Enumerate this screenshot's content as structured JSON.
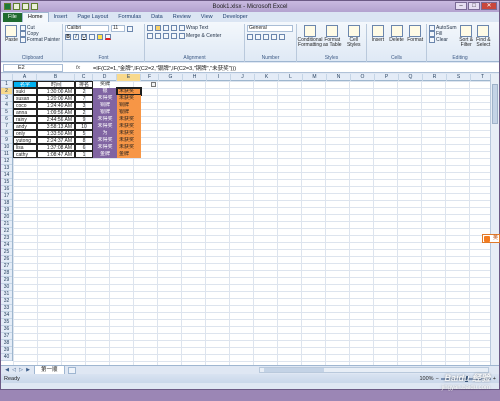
{
  "window": {
    "title": "Book1.xlsx - Microsoft Excel"
  },
  "ribbon_tabs": [
    "File",
    "Home",
    "Insert",
    "Page Layout",
    "Formulas",
    "Data",
    "Review",
    "View",
    "Developer"
  ],
  "ribbon": {
    "clipboard": {
      "paste": "Paste",
      "cut": "Cut",
      "copy": "Copy",
      "format_painter": "Format Painter",
      "label": "Clipboard"
    },
    "font": {
      "name": "Calibri",
      "size": "11",
      "label": "Font"
    },
    "alignment": {
      "wrap": "Wrap Text",
      "merge": "Merge & Center",
      "label": "Alignment"
    },
    "number": {
      "format": "General",
      "label": "Number"
    },
    "styles": {
      "conditional": "Conditional Formatting",
      "format_table": "Format as Table",
      "cell_styles": "Cell Styles",
      "label": "Styles"
    },
    "cells": {
      "insert": "Insert",
      "delete": "Delete",
      "format": "Format",
      "label": "Cells"
    },
    "editing": {
      "autosum": "AutoSum",
      "fill": "Fill",
      "clear": "Clear",
      "sort": "Sort & Filter",
      "find": "Find & Select",
      "label": "Editing"
    }
  },
  "formula_bar": {
    "name_box": "E2",
    "fx": "fx",
    "formula": "=IF(C2=1,\"金牌\",IF(C2=2,\"银牌\",IF(C2=3,\"铜牌\",\"未获奖\")))"
  },
  "columns": [
    "A",
    "B",
    "C",
    "D",
    "E",
    "F",
    "G",
    "H",
    "I",
    "J",
    "K",
    "L",
    "M",
    "N",
    "O",
    "P",
    "Q",
    "R",
    "S",
    "T"
  ],
  "rows": [
    "1",
    "2",
    "3",
    "4",
    "5",
    "6",
    "7",
    "8",
    "9",
    "10",
    "11",
    "12",
    "13",
    "14",
    "15",
    "16",
    "17",
    "18",
    "19",
    "20",
    "21",
    "22",
    "23",
    "24",
    "25",
    "26",
    "27",
    "28",
    "29",
    "30",
    "31",
    "32",
    "33",
    "34",
    "35",
    "36",
    "37",
    "38",
    "39",
    "40"
  ],
  "table": {
    "headers": [
      "名字",
      "时间",
      "排名",
      "奖牌"
    ],
    "rows": [
      [
        "suki",
        "1:30:00 AM",
        "2",
        "银",
        "未获奖"
      ],
      [
        "susan",
        "1:20:00 AM",
        "7",
        "未得奖",
        "未获奖"
      ],
      [
        "coco",
        "1:24:40 AM",
        "3",
        "铜牌",
        "铜牌"
      ],
      [
        "anna",
        "1:09:56 AM",
        "2",
        "银牌",
        "银牌"
      ],
      [
        "rainy",
        "2:44:56 AM",
        "9",
        "未得奖",
        "未获奖"
      ],
      [
        "andy",
        "3:58:13 AM",
        "10",
        "未得奖",
        "未获奖"
      ],
      [
        "only",
        "1:33:50 AM",
        "5",
        "为",
        "未获奖"
      ],
      [
        "yutong",
        "2:24:37 AM",
        "8",
        "未得奖",
        "未获奖"
      ],
      [
        "lisa",
        "1:37:08 AM",
        "6",
        "未得奖",
        "未获奖"
      ],
      [
        "cathy",
        "1:08:47 AM",
        "1",
        "金牌",
        "金牌"
      ]
    ]
  },
  "sheet_tab": "第一顺",
  "status": {
    "ready": "Ready",
    "zoom": "100%"
  },
  "side_widget": "英",
  "watermark": {
    "line1": "Baidu 经验",
    "line2": "jingyan.baidu.com"
  }
}
